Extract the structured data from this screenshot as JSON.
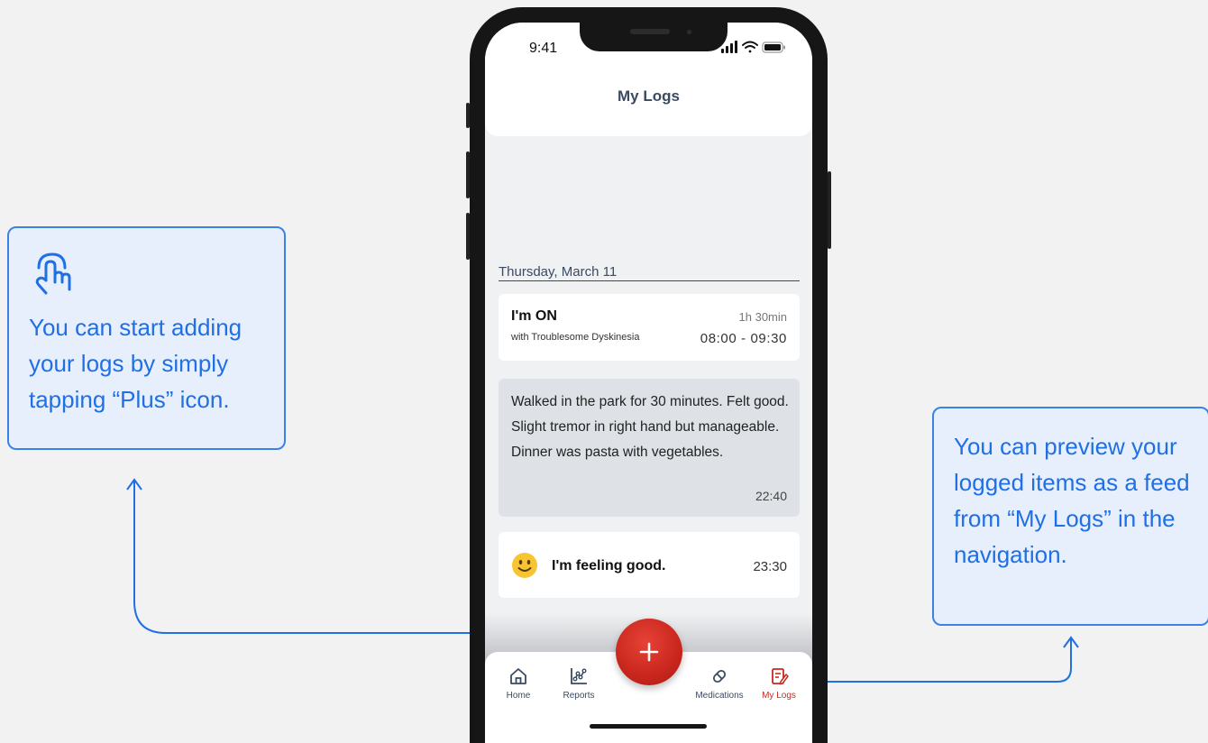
{
  "callouts": {
    "left": "You can start adding your logs by simply tapping “Plus” icon.",
    "right": "You can preview your logged items as a feed from “My Logs” in the navigation."
  },
  "status_bar": {
    "time": "9:41"
  },
  "header": {
    "title": "My Logs"
  },
  "feed": {
    "date": "Thursday, March 11",
    "on_entry": {
      "title": "I'm ON",
      "subtitle": "with Troublesome Dyskinesia",
      "duration": "1h 30min",
      "range": "08:00 - 09:30"
    },
    "note_entry": {
      "text": "Walked in the park for 30 minutes. Felt good. Slight tremor in right hand but manageable. Dinner was pasta with vegetables.",
      "time": "22:40"
    },
    "mood_entry": {
      "icon": "smile-emoji",
      "text": "I'm feeling good.",
      "time": "23:30"
    }
  },
  "nav": {
    "items": [
      {
        "label": "Home",
        "icon": "home-icon"
      },
      {
        "label": "Reports",
        "icon": "reports-icon"
      },
      {
        "label": "Medications",
        "icon": "pill-icon"
      },
      {
        "label": "My Logs",
        "icon": "my-logs-icon",
        "active": true
      }
    ],
    "fab_icon": "plus-icon"
  },
  "colors": {
    "accent_blue": "#1f6fe5",
    "callout_bg": "#e7effc",
    "fab_red": "#c9261d",
    "nav_active": "#c9281e",
    "text_dark": "#3a4a62"
  }
}
